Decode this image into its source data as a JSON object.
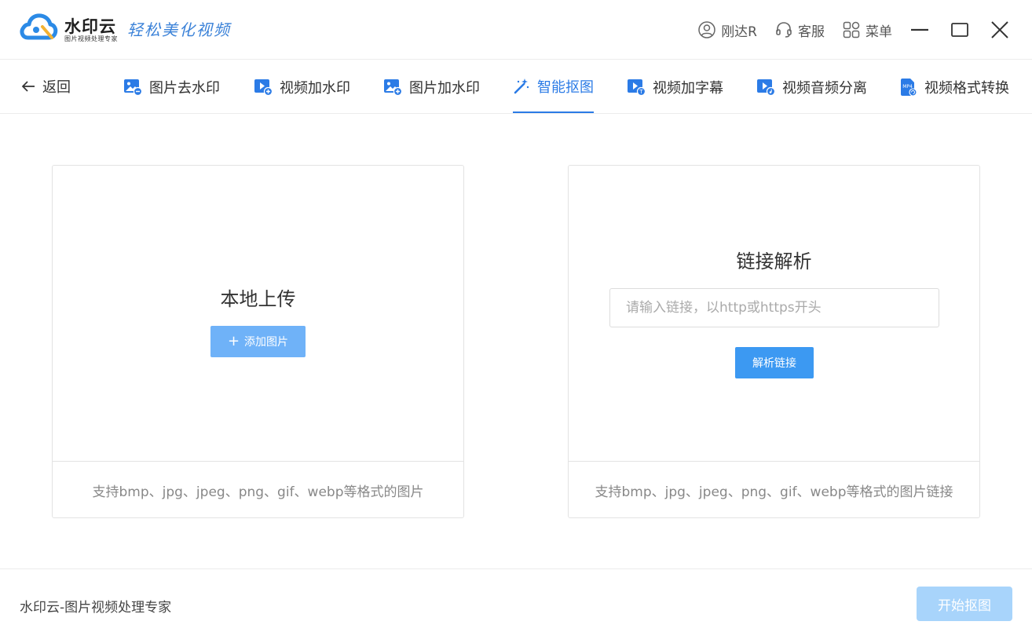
{
  "app": {
    "brand_name": "水印云",
    "brand_sub": "图片视频处理专家",
    "slogan": "轻松美化视频",
    "accent_color": "#2b7be6"
  },
  "top_actions": {
    "user": {
      "label": "刚达R",
      "icon": "user-icon"
    },
    "service": {
      "label": "客服",
      "icon": "headset-icon"
    },
    "menu": {
      "label": "菜单",
      "icon": "grid-icon"
    }
  },
  "window_controls": [
    "minimize-icon",
    "maximize-icon",
    "close-icon"
  ],
  "nav": {
    "back_label": "返回",
    "tabs": [
      {
        "label": "图片去水印",
        "icon": "image-minus-icon",
        "active": false
      },
      {
        "label": "视频加水印",
        "icon": "video-plus-icon",
        "active": false
      },
      {
        "label": "图片加水印",
        "icon": "image-plus-icon",
        "active": false
      },
      {
        "label": "智能抠图",
        "icon": "magic-wand-icon",
        "active": true
      },
      {
        "label": "视频加字幕",
        "icon": "video-subtitle-icon",
        "active": false
      },
      {
        "label": "视频音频分离",
        "icon": "video-audio-icon",
        "active": false
      },
      {
        "label": "视频格式转换",
        "icon": "mp4-file-icon",
        "active": false
      }
    ]
  },
  "local_upload": {
    "title": "本地上传",
    "button": "添加图片",
    "hint": "支持bmp、jpg、jpeg、png、gif、webp等格式的图片"
  },
  "link_parse": {
    "title": "链接解析",
    "input_placeholder": "请输入链接，以http或https开头",
    "input_value": "",
    "button": "解析链接",
    "hint": "支持bmp、jpg、jpeg、png、gif、webp等格式的图片链接"
  },
  "footer": {
    "text": "水印云-图片视频处理专家",
    "start_button": "开始抠图"
  }
}
